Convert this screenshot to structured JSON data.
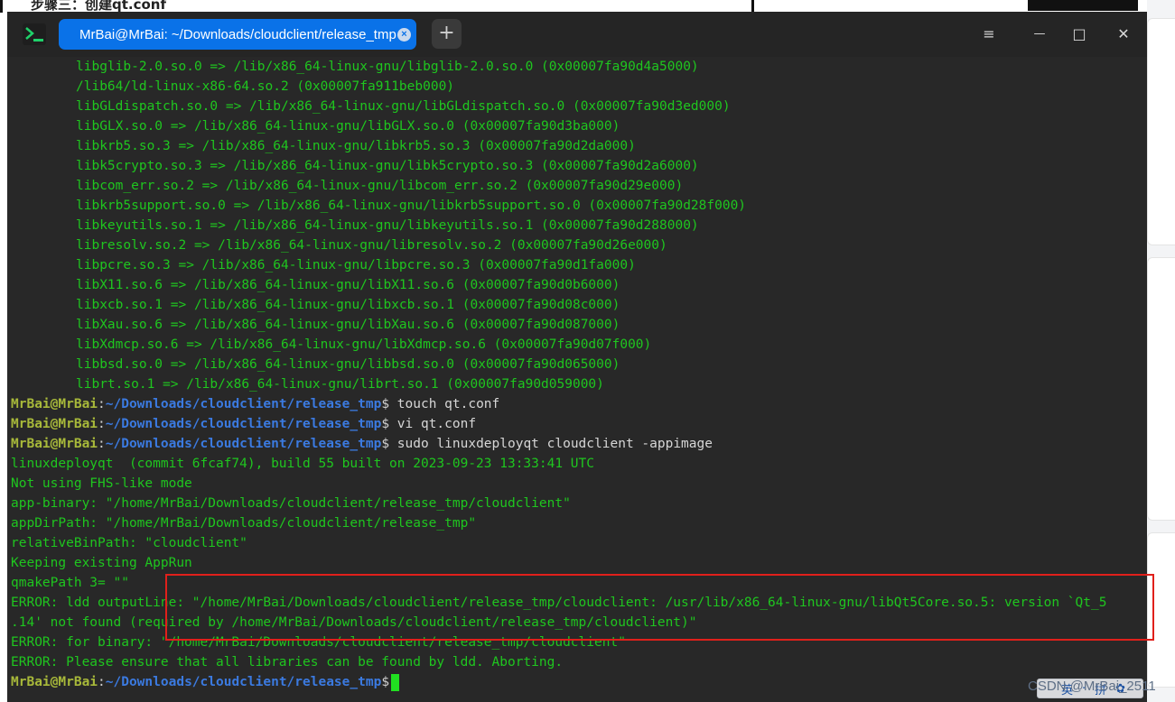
{
  "background": {
    "heading": "步骤三：创建qt.conf"
  },
  "window": {
    "tab_title": "MrBai@MrBai: ~/Downloads/cloudclient/release_tmp",
    "tab_close_glyph": "×",
    "add_tab_glyph": "+",
    "controls": {
      "menu": "≡",
      "minimize": "—",
      "maximize": "□",
      "close": "✕"
    }
  },
  "prompt": {
    "user": "MrBai@MrBai",
    "sep": ":",
    "path": "~/Downloads/cloudclient/release_tmp",
    "dollar": "$"
  },
  "terminal": {
    "lib_lines": [
      "libglib-2.0.so.0 => /lib/x86_64-linux-gnu/libglib-2.0.so.0 (0x00007fa90d4a5000)",
      "/lib64/ld-linux-x86-64.so.2 (0x00007fa911beb000)",
      "libGLdispatch.so.0 => /lib/x86_64-linux-gnu/libGLdispatch.so.0 (0x00007fa90d3ed000)",
      "libGLX.so.0 => /lib/x86_64-linux-gnu/libGLX.so.0 (0x00007fa90d3ba000)",
      "libkrb5.so.3 => /lib/x86_64-linux-gnu/libkrb5.so.3 (0x00007fa90d2da000)",
      "libk5crypto.so.3 => /lib/x86_64-linux-gnu/libk5crypto.so.3 (0x00007fa90d2a6000)",
      "libcom_err.so.2 => /lib/x86_64-linux-gnu/libcom_err.so.2 (0x00007fa90d29e000)",
      "libkrb5support.so.0 => /lib/x86_64-linux-gnu/libkrb5support.so.0 (0x00007fa90d28f000)",
      "libkeyutils.so.1 => /lib/x86_64-linux-gnu/libkeyutils.so.1 (0x00007fa90d288000)",
      "libresolv.so.2 => /lib/x86_64-linux-gnu/libresolv.so.2 (0x00007fa90d26e000)",
      "libpcre.so.3 => /lib/x86_64-linux-gnu/libpcre.so.3 (0x00007fa90d1fa000)",
      "libX11.so.6 => /lib/x86_64-linux-gnu/libX11.so.6 (0x00007fa90d0b6000)",
      "libxcb.so.1 => /lib/x86_64-linux-gnu/libxcb.so.1 (0x00007fa90d08c000)",
      "libXau.so.6 => /lib/x86_64-linux-gnu/libXau.so.6 (0x00007fa90d087000)",
      "libXdmcp.so.6 => /lib/x86_64-linux-gnu/libXdmcp.so.6 (0x00007fa90d07f000)",
      "libbsd.so.0 => /lib/x86_64-linux-gnu/libbsd.so.0 (0x00007fa90d065000)",
      "librt.so.1 => /lib/x86_64-linux-gnu/librt.so.1 (0x00007fa90d059000)"
    ],
    "commands": [
      " touch qt.conf",
      " vi qt.conf",
      " sudo linuxdeployqt cloudclient -appimage"
    ],
    "output_lines": [
      "linuxdeployqt  (commit 6fcaf74), build 55 built on 2023-09-23 13:33:41 UTC",
      "Not using FHS-like mode",
      "app-binary: \"/home/MrBai/Downloads/cloudclient/release_tmp/cloudclient\"",
      "appDirPath: \"/home/MrBai/Downloads/cloudclient/release_tmp\"",
      "relativeBinPath: \"cloudclient\"",
      "Keeping existing AppRun",
      "qmakePath 3= \"\"",
      "ERROR: ldd outputLine: \"/home/MrBai/Downloads/cloudclient/release_tmp/cloudclient: /usr/lib/x86_64-linux-gnu/libQt5Core.so.5: version `Qt_5",
      ".14' not found (required by /home/MrBai/Downloads/cloudclient/release_tmp/cloudclient)\"",
      "ERROR: for binary: \"/home/MrBai/Downloads/cloudclient/release_tmp/cloudclient\"",
      "ERROR: Please ensure that all libraries can be found by ldd. Aborting."
    ]
  },
  "overlay": {
    "watermark": "CSDN @MrBai_2511",
    "ime_chars": [
      "英",
      "·",
      "拼",
      "✿"
    ]
  },
  "colors": {
    "terminal_bg": "#282828",
    "output_green": "#1fc61f",
    "prompt_user": "#a8b93a",
    "prompt_path": "#3b7ae0",
    "tab_active": "#0a72e8",
    "highlight_red": "#e0201b"
  }
}
